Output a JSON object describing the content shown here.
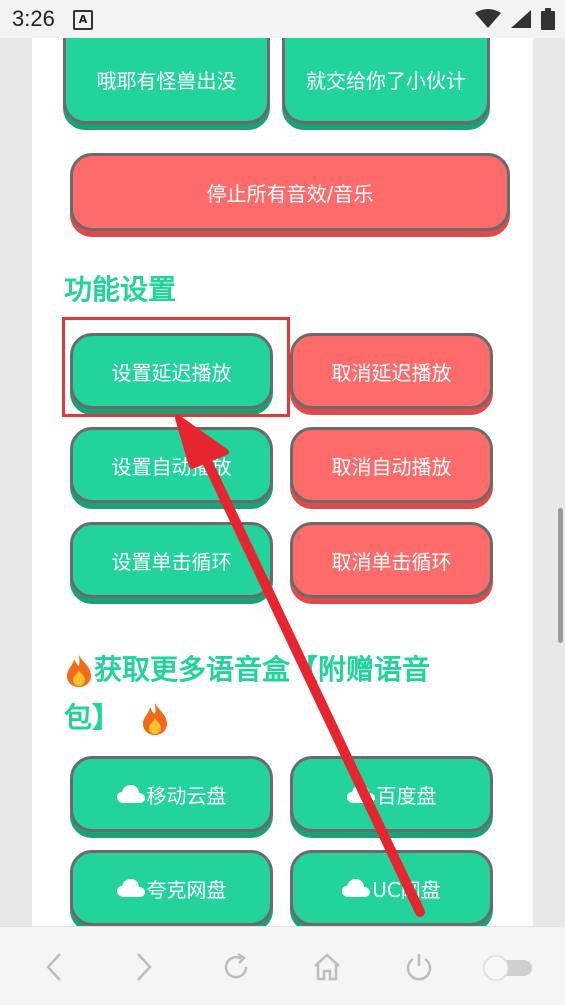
{
  "status_bar": {
    "time": "3:26",
    "app_icon_letter": "A",
    "icons": [
      "wifi-icon",
      "signal-icon",
      "battery-icon"
    ]
  },
  "top_buttons": [
    {
      "label": "哦耶有怪兽出没",
      "color": "green"
    },
    {
      "label": "就交给你了小伙计",
      "color": "green"
    }
  ],
  "stop_button": {
    "label": "停止所有音效/音乐",
    "color": "red"
  },
  "settings": {
    "title": "功能设置",
    "rows": [
      {
        "set": "设置延迟播放",
        "cancel": "取消延迟播放"
      },
      {
        "set": "设置自动播放",
        "cancel": "取消自动播放"
      },
      {
        "set": "设置单击循环",
        "cancel": "取消单击循环"
      }
    ]
  },
  "promo": {
    "title": "获取更多语音盒【附赠语音包】",
    "title_part1": "获取更多语音盒【附赠语音",
    "title_part2": "包】",
    "icon": "fire-icon"
  },
  "cloud_buttons": [
    {
      "label": "移动云盘",
      "icon": "cloud-icon"
    },
    {
      "label": "百度盘",
      "icon": "cloud-icon"
    },
    {
      "label": "夸克网盘",
      "icon": "cloud-icon"
    },
    {
      "label": "UC网盘",
      "icon": "cloud-icon"
    }
  ],
  "nav_bar": {
    "items": [
      "back-icon",
      "forward-icon",
      "refresh-icon",
      "home-icon",
      "power-icon",
      "toggle-switch"
    ]
  },
  "colors": {
    "green": "#22d39b",
    "red": "#fe6b6b",
    "highlight": "#e53838"
  }
}
